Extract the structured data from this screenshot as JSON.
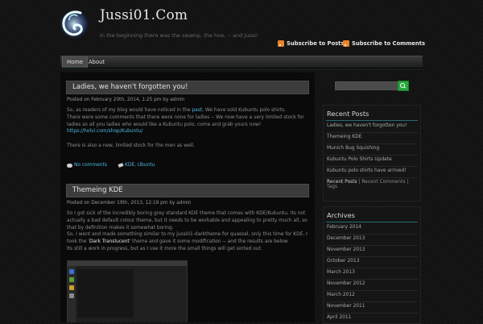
{
  "header": {
    "site_title": "Jussi01.Com",
    "tagline": "In the beginning there was the swamp, the hoe, -- and Jussi!",
    "subscribe_posts": "Subscribe to Posts",
    "subscribe_comments": "Subscribe to Comments"
  },
  "nav": {
    "items": [
      "Home",
      "About"
    ]
  },
  "posts": [
    {
      "title": "Ladies, we haven't forgotten you!",
      "meta": "Posted on February 20th, 2014, 1:25 pm by admin",
      "body": {
        "l1_a": "So, as readers of my blog would have noticed in the ",
        "l1_link": "past",
        "l1_b": ", We have sold Kubuntu polo shirts.",
        "l2": "There were some comments that there were none for ladies -- We now have a very limited stock for",
        "l3": "ladies so all you ladies who would like a Kubuntu polo, come and grab yours now!",
        "l4_link": "https://holvi.com/shop/Kubuntu/",
        "l5": "There is also a new, limited stock for the men as well."
      },
      "comments": "No comments",
      "tags": "KDE, Ubuntu"
    },
    {
      "title": "Themeing KDE",
      "meta": "Posted on December 19th, 2013, 12:19 pm by admin",
      "body": {
        "l1": "So I got sick of the incredibly boring grey standard KDE theme that comes with KDE/Kubuntu. Its not",
        "l2": "actually a bad default colour theme, but it needs to be workable and appealing to pretty much all, so",
        "l3": "that by definition makes it somewhat boring.",
        "l4_a": "So, I went and made something similar to my jussi01-darktheme for quassel, only this time for KDE. I",
        "l5_a": "took the '",
        "l5_hl": "Dark Translucent",
        "l5_b": "' theme and gave it some modification -- and the results are below.",
        "l6": "Its still a work in progress, but as I use it more the small things will get sorted out."
      }
    }
  ],
  "sidebar": {
    "recent_posts_title": "Recent Posts",
    "recent_posts": [
      "Ladies, we haven't forgotten you!",
      "Themeing KDE",
      "Munich Bug Squishing",
      "Kubuntu Polo Shirts Update",
      "Kubuntu polo shirts have arrived!"
    ],
    "tabs": [
      "Recent Posts",
      "Recent Comments",
      "Tags"
    ],
    "archives_title": "Archives",
    "archives": [
      "February 2014",
      "December 2013",
      "November 2013",
      "October 2013",
      "March 2013",
      "November 2012",
      "March 2012",
      "November 2011",
      "April 2011"
    ]
  },
  "colors": {
    "accent": "#4fb8e0",
    "search_button": "#27a83a",
    "rss": "#e8852a"
  }
}
